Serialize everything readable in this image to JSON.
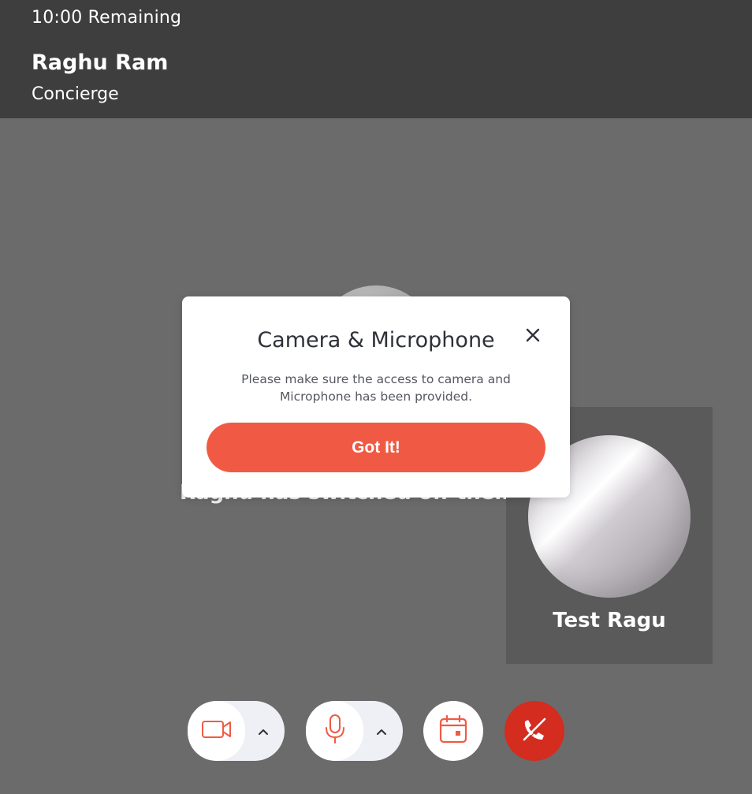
{
  "header": {
    "timer": "10:00 Remaining",
    "host_name": "Raghu Ram",
    "host_role": "Concierge"
  },
  "main": {
    "status_text": "Raghu has switched off their camera"
  },
  "self_tile": {
    "name": "Test Ragu"
  },
  "dialog": {
    "title": "Camera & Microphone",
    "message": "Please make sure the access to camera and Microphone has been provided.",
    "button_label": "Got It!",
    "close_icon": "close-icon"
  },
  "controls": {
    "camera_icon": "video-camera-icon",
    "mic_icon": "microphone-icon",
    "calendar_icon": "calendar-icon",
    "hangup_icon": "phone-off-icon"
  },
  "colors": {
    "accent": "#f05a44",
    "hangup": "#d42c1e",
    "header_bg": "#3e3e3e",
    "stage_bg": "#6b6b6b"
  }
}
